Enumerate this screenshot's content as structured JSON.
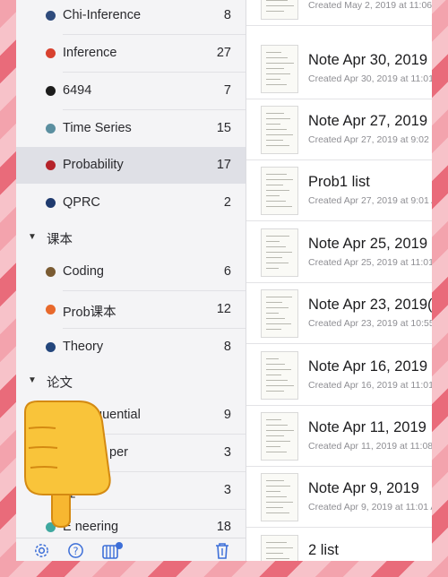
{
  "sidebar": {
    "top_partial": {
      "label": "Chi-Inference",
      "count": "8",
      "color": "#2f4b7c"
    },
    "items": [
      {
        "label": "Inference",
        "count": "27",
        "color": "#d8412f"
      },
      {
        "label": "6494",
        "count": "7",
        "color": "#1c1c1c"
      },
      {
        "label": "Time Series",
        "count": "15",
        "color": "#5b8fa0"
      },
      {
        "label": "Probability",
        "count": "17",
        "color": "#b5232a"
      },
      {
        "label": "QPRC",
        "count": "2",
        "color": "#1f3a6e"
      }
    ],
    "group1": {
      "label": "课本"
    },
    "group1_items": [
      {
        "label": "Coding",
        "count": "6",
        "color": "#7a5b32"
      },
      {
        "label": "Prob课本",
        "count": "12",
        "color": "#e8692c"
      },
      {
        "label": "Theory",
        "count": "8",
        "color": "#23467c"
      }
    ],
    "group2": {
      "label": "论文"
    },
    "group2_items": [
      {
        "label": "quential",
        "count": "9",
        "color": "#3a6fa5"
      },
      {
        "label": "per",
        "count": "3",
        "color": "#3d8a6a"
      },
      {
        "label": "互",
        "count": "3",
        "color": "#6b3fa0"
      },
      {
        "label": "E   neering",
        "count": "18",
        "color": "#3fa8a0"
      }
    ]
  },
  "toolbar": {
    "settings_icon": "gear-icon",
    "help_icon": "question-icon",
    "add_icon": "folder-add-icon",
    "trash_icon": "trash-icon"
  },
  "notes": [
    {
      "title": "",
      "subtitle": "Created May 2, 2019 at 11:06"
    },
    {
      "title": "Note Apr 30, 2019",
      "subtitle": "Created Apr 30, 2019 at 11:01"
    },
    {
      "title": "Note Apr 27, 2019",
      "subtitle": "Created Apr 27, 2019 at 9:02"
    },
    {
      "title": "Prob1 list",
      "subtitle": "Created Apr 27, 2019 at 9:01 A"
    },
    {
      "title": "Note Apr 25, 2019",
      "subtitle": "Created Apr 25, 2019 at 11:01"
    },
    {
      "title": "Note Apr 23, 2019(",
      "subtitle": "Created Apr 23, 2019 at 10:55"
    },
    {
      "title": "Note Apr 16, 2019",
      "subtitle": "Created Apr 16, 2019 at 11:01"
    },
    {
      "title": "Note Apr 11, 2019",
      "subtitle": "Created Apr 11, 2019 at 11:08"
    },
    {
      "title": "Note Apr 9, 2019",
      "subtitle": "Created Apr 9, 2019 at 11:01 A"
    },
    {
      "title": "2 list",
      "subtitle": ""
    }
  ]
}
